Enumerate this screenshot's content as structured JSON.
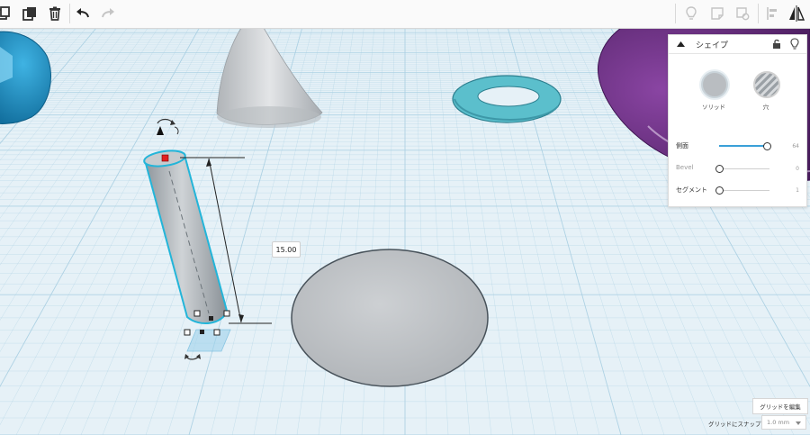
{
  "toolbar": {
    "left_icons": [
      "copy-icon",
      "duplicate-icon",
      "trash-icon",
      "undo-icon",
      "redo-icon"
    ],
    "right_icons": [
      "lightbulb-icon",
      "note-icon",
      "shape-note-icon",
      "align-icon",
      "mirror-icon"
    ]
  },
  "dimension": {
    "height_value": "15.00"
  },
  "panel": {
    "title": "シェイプ",
    "solid_label": "ソリッド",
    "hole_label": "穴",
    "props": [
      {
        "label": "側面",
        "value": "64",
        "level": 0.95,
        "enabled": true
      },
      {
        "label": "Bevel",
        "value": "0",
        "level": 0.0,
        "enabled": false
      },
      {
        "label": "セグメント",
        "value": "1",
        "level": 0.0,
        "enabled": true
      }
    ]
  },
  "grid": {
    "edit_grid_label": "グリッドを編集",
    "snap_label": "グリッドにスナップ",
    "snap_value": "1.0 mm"
  },
  "colors": {
    "workplane": "#e6f1f7",
    "grid_line": "#a9cfe2",
    "selection": "#23b5d9",
    "cylinder": "#b7bcc1",
    "torus": "#5bbfcc",
    "blue_shape": "#1f8fc3",
    "purple_shape": "#6b2f82",
    "slider_accent": "#3aa0d8"
  }
}
